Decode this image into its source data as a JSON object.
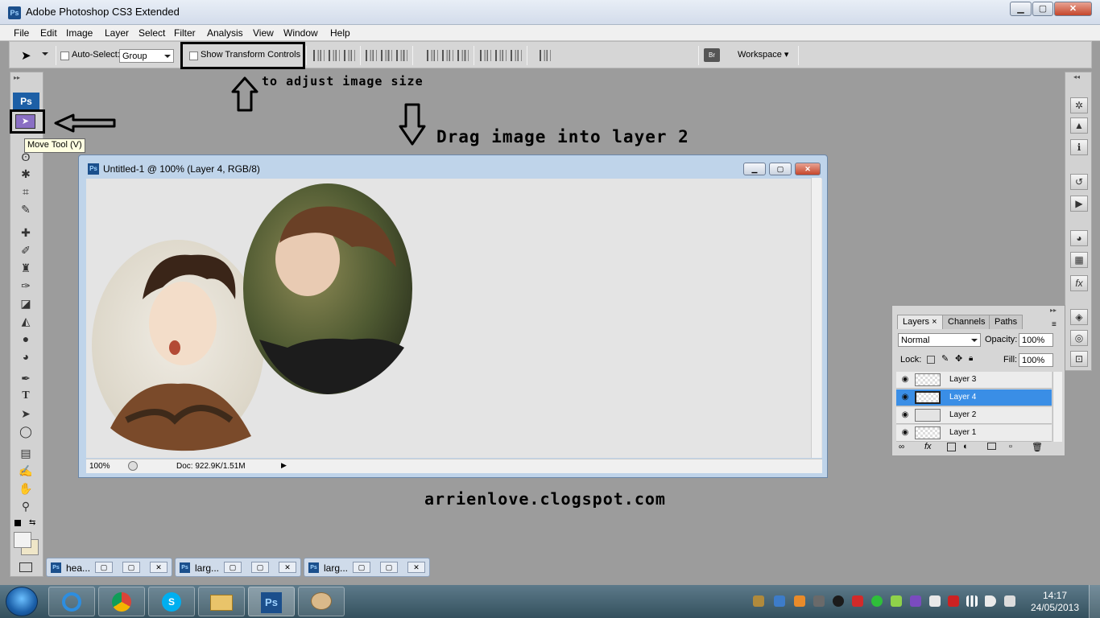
{
  "window": {
    "title": "Adobe Photoshop CS3 Extended",
    "app_icon": "Ps",
    "controls": {
      "minimize": "▁",
      "maximize": "▢",
      "close": "✕"
    }
  },
  "menu": [
    "File",
    "Edit",
    "Image",
    "Layer",
    "Select",
    "Filter",
    "Analysis",
    "View",
    "Window",
    "Help"
  ],
  "options_bar": {
    "auto_select_label": "Auto-Select:",
    "auto_select_value": "Group",
    "show_transform_label": "Show Transform Controls",
    "workspace_label": "Workspace ▾"
  },
  "toolbox": {
    "logo": "Ps",
    "tooltip": "Move Tool (V)"
  },
  "annotations": {
    "adjust": "to adjust image size",
    "drag": "Drag image into layer 2",
    "blog": "arrienlove.clogspot.com"
  },
  "document": {
    "title": "Untitled-1 @ 100% (Layer 4, RGB/8)",
    "zoom": "100%",
    "doc_info": "Doc: 922.9K/1.51M"
  },
  "layers_panel": {
    "tabs": [
      "Layers",
      "Channels",
      "Paths"
    ],
    "blend_mode": "Normal",
    "opacity_label": "Opacity:",
    "opacity_value": "100%",
    "lock_label": "Lock:",
    "fill_label": "Fill:",
    "fill_value": "100%",
    "layers": [
      {
        "name": "Layer 3",
        "selected": false
      },
      {
        "name": "Layer 4",
        "selected": true
      },
      {
        "name": "Layer 2",
        "selected": false
      },
      {
        "name": "Layer 1",
        "selected": false
      }
    ]
  },
  "minimized_docs": [
    "hea...",
    "larg...",
    "larg..."
  ],
  "taskbar": {
    "time": "14:17",
    "date": "24/05/2013"
  },
  "colors": {
    "selected_layer": "#3a8ee6",
    "tooltip_bg": "#ffffe1",
    "workspace_bg": "#9c9c9c"
  }
}
